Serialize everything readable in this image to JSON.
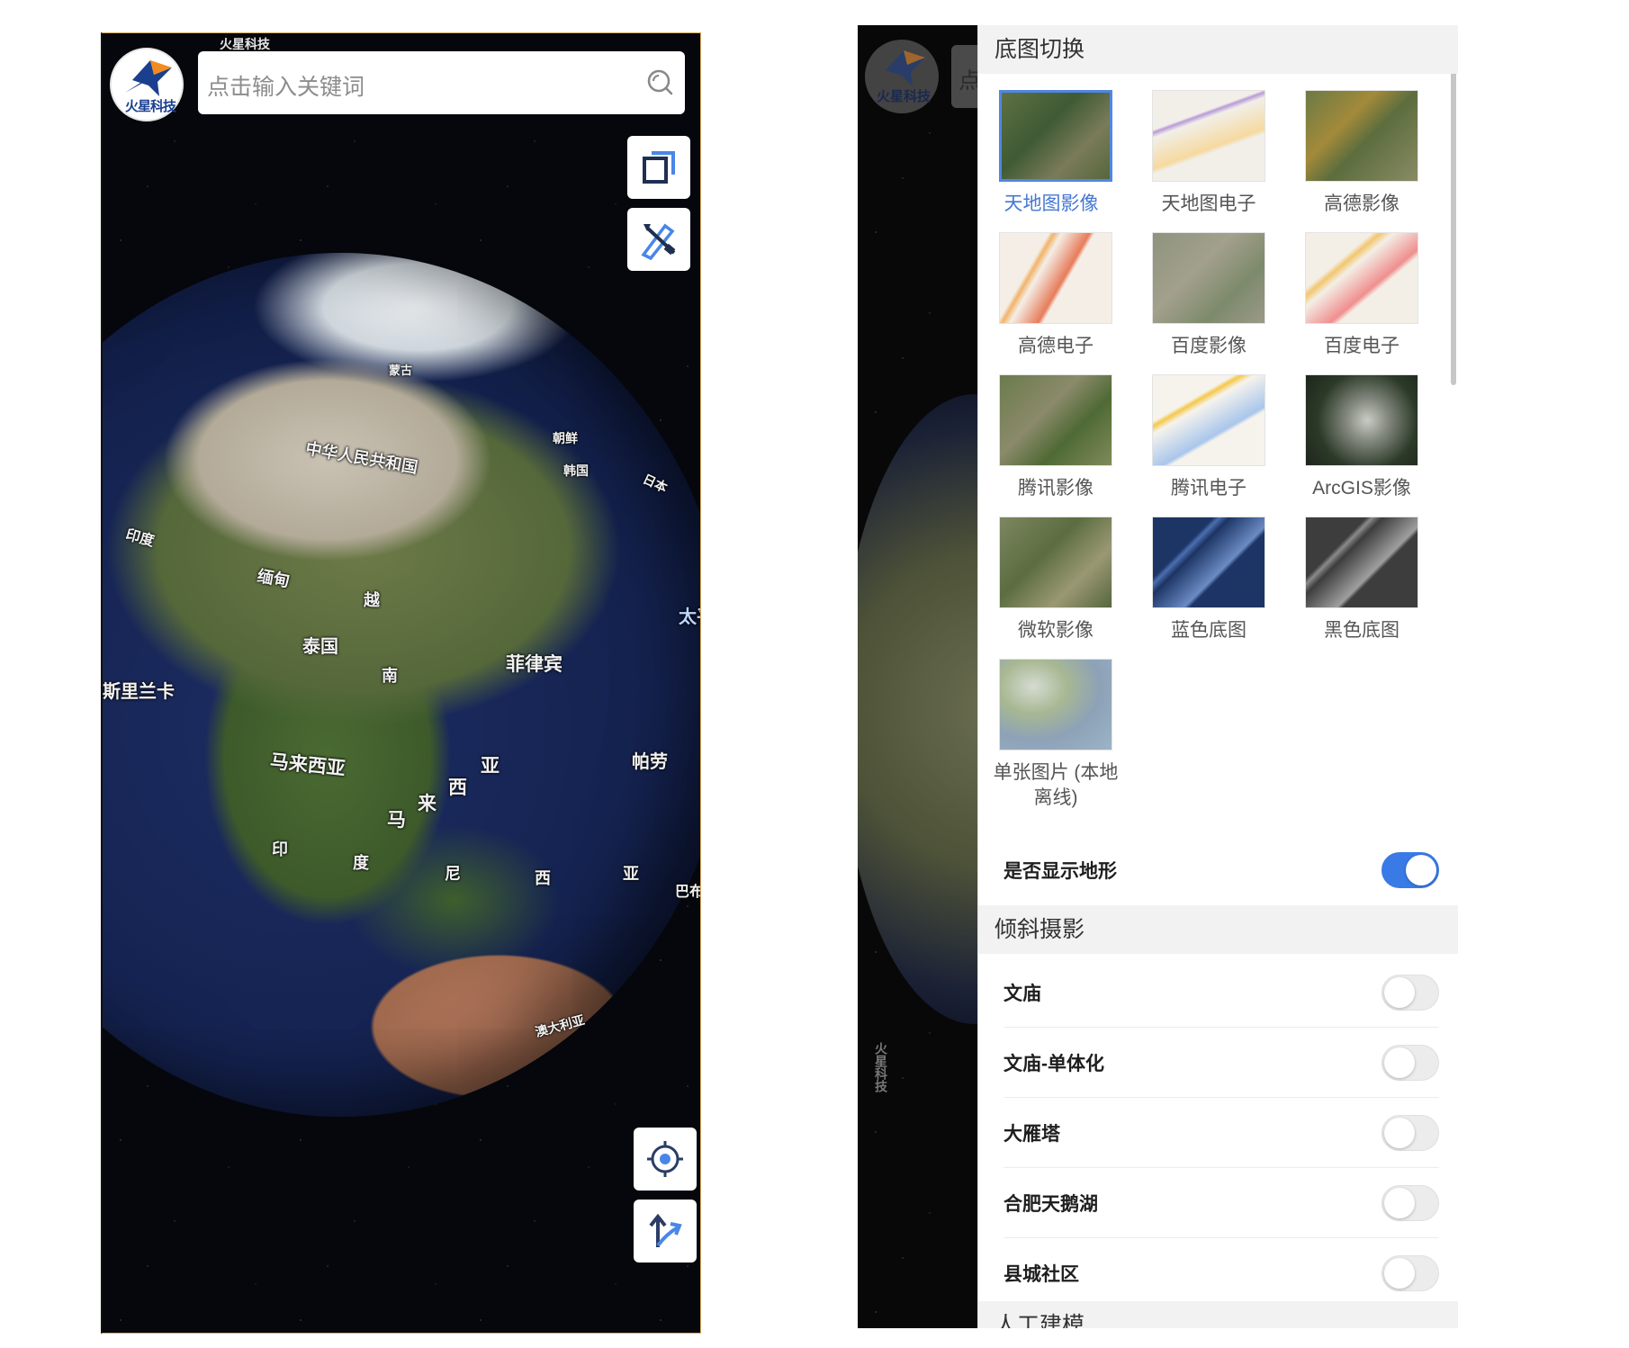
{
  "left_screen": {
    "watermark": "火星科技",
    "logo_text": "火星科技",
    "search": {
      "placeholder": "点击输入关键词"
    },
    "globe_labels": [
      "蒙古",
      "中华人民共和国",
      "朝鲜",
      "韩国",
      "日本",
      "印度",
      "缅甸",
      "越",
      "泰国",
      "南",
      "菲律宾",
      "斯里兰卡",
      "马来西亚",
      "马",
      "来",
      "西",
      "亚",
      "帕劳",
      "印",
      "度",
      "尼",
      "西",
      "亚",
      "澳大利亚",
      "巴布",
      "太平"
    ],
    "toolbar_icons": [
      "layers-icon",
      "measure-ruler-icon"
    ],
    "bottom_icons": [
      "locate-icon",
      "route-icon"
    ]
  },
  "right_screen": {
    "logo_text": "火星科技",
    "search_stub": "点",
    "side_watermark": "火星科技",
    "sections": {
      "basemap": "底图切换",
      "oblique": "倾斜摄影",
      "manual": "人工建模"
    },
    "basemaps": [
      {
        "label": "天地图影像",
        "selected": true
      },
      {
        "label": "天地图电子",
        "selected": false
      },
      {
        "label": "高德影像",
        "selected": false
      },
      {
        "label": "高德电子",
        "selected": false
      },
      {
        "label": "百度影像",
        "selected": false
      },
      {
        "label": "百度电子",
        "selected": false
      },
      {
        "label": "腾讯影像",
        "selected": false
      },
      {
        "label": "腾讯电子",
        "selected": false
      },
      {
        "label": "ArcGIS影像",
        "selected": false
      },
      {
        "label": "微软影像",
        "selected": false
      },
      {
        "label": "蓝色底图",
        "selected": false
      },
      {
        "label": "黑色底图",
        "selected": false
      },
      {
        "label_line1": "单张图片 (本地",
        "label_line2": "离线)",
        "selected": false
      }
    ],
    "terrain_toggle": {
      "label": "是否显示地形",
      "on": true
    },
    "oblique_items": [
      {
        "label": "文庙",
        "on": false
      },
      {
        "label": "文庙-单体化",
        "on": false
      },
      {
        "label": "大雁塔",
        "on": false
      },
      {
        "label": "合肥天鹅湖",
        "on": false
      },
      {
        "label": "县城社区",
        "on": false
      }
    ],
    "colors": {
      "accent": "#3a7ae6",
      "selected_border": "#5087e3"
    }
  }
}
